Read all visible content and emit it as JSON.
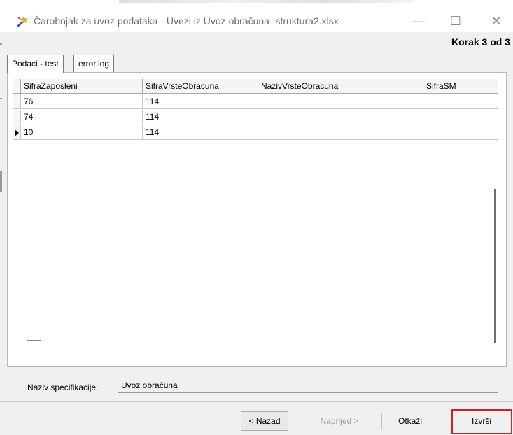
{
  "window": {
    "title": "Čarobnjak za uvoz podataka - Uvezi iz Uvoz obračuna -struktura2.xlsx",
    "step": "Korak 3 od 3",
    "icons": {
      "app": "wand-icon",
      "minimize": "minimize-icon",
      "maximize": "maximize-icon",
      "close": "close-icon"
    },
    "minimize_glyph": "—",
    "maximize_glyph": "☐",
    "close_glyph": "✕"
  },
  "tabs": [
    {
      "label": "Podaci - test",
      "active": true
    },
    {
      "label": "error.log",
      "active": false
    }
  ],
  "grid": {
    "columns": [
      "SifraZaposleni",
      "SifraVrsteObracuna",
      "NazivVrsteObracuna",
      "SifraSM"
    ],
    "rows": [
      [
        "76",
        "114",
        "",
        ""
      ],
      [
        "74",
        "114",
        "",
        ""
      ],
      [
        "10",
        "114",
        "",
        ""
      ]
    ],
    "current_row": 3
  },
  "specification": {
    "label": "Naziv specifikacije:",
    "value": "Uvoz obračuna"
  },
  "buttons": {
    "back": {
      "prefix": "< ",
      "accel": "N",
      "rest": "azad"
    },
    "next": {
      "accel": "N",
      "rest": "aprijed >"
    },
    "cancel": {
      "accel": "O",
      "rest": "tkaži"
    },
    "finish": {
      "accel": "I",
      "rest": "zvrši"
    }
  },
  "colors": {
    "highlight": "#d0202a"
  }
}
